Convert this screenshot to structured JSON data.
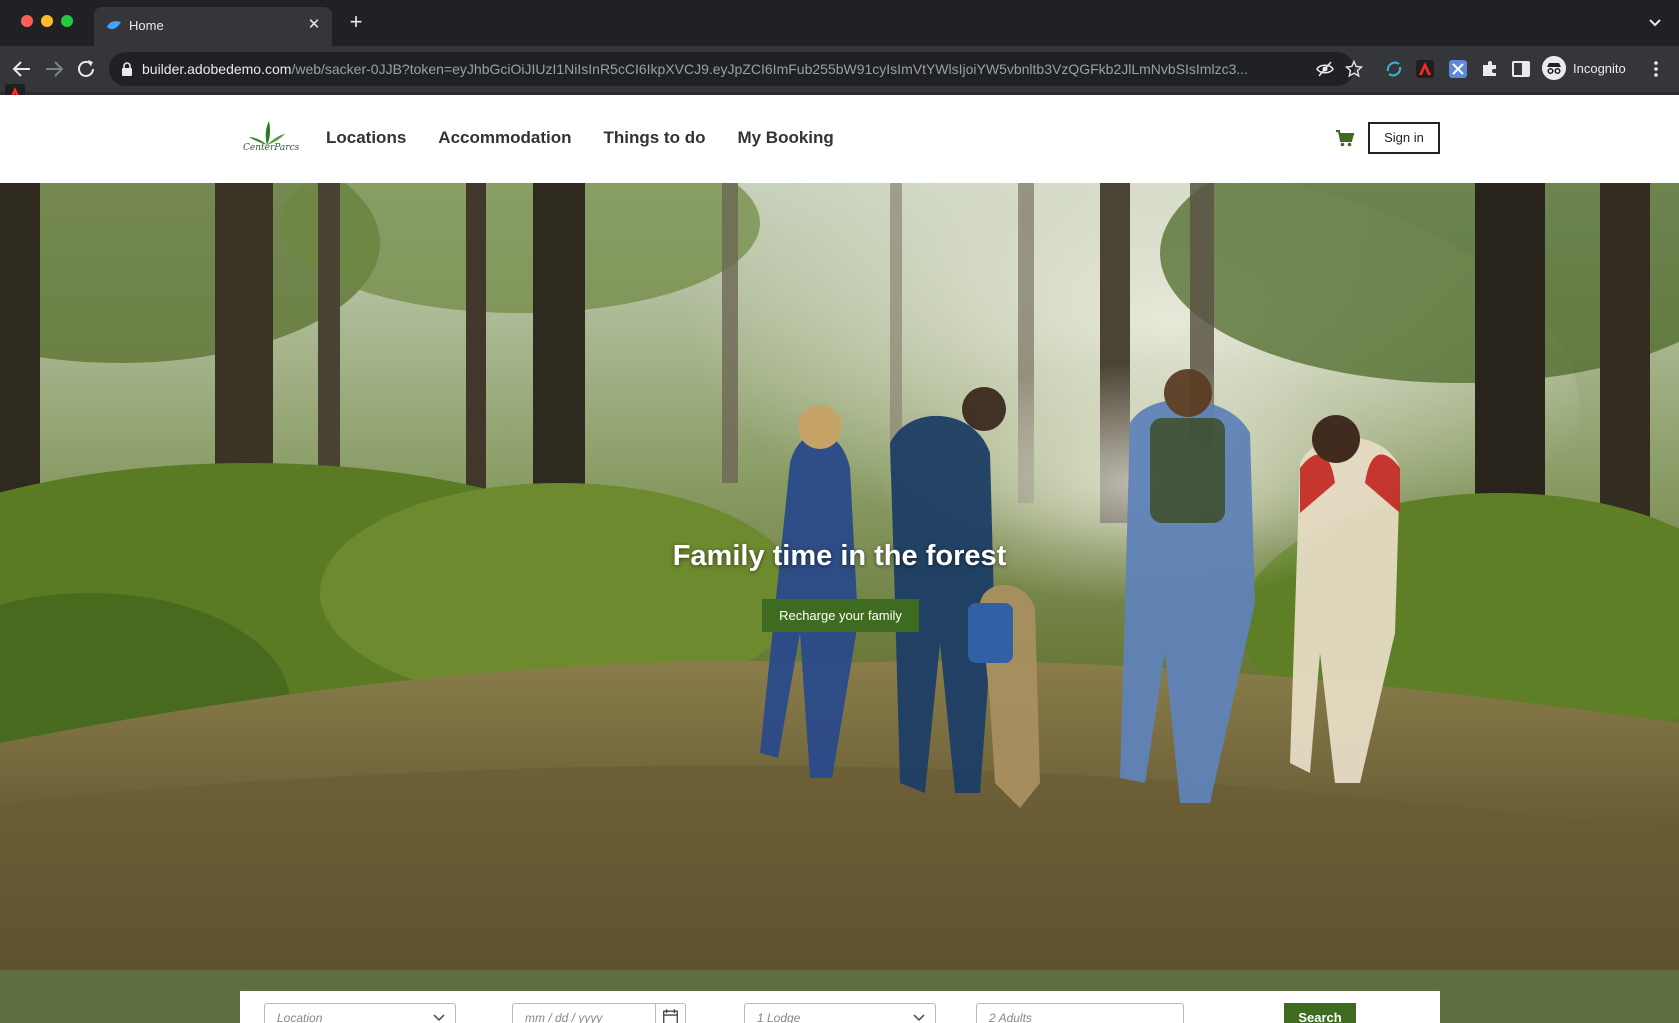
{
  "browser": {
    "tab_title": "Home",
    "new_tab_icon": "+",
    "url_host": "builder.adobedemo.com",
    "url_path": "/web/sacker-0JJB?token=eyJhbGciOiJIUzI1NiIsInR5cCI6IkpXVCJ9.eyJpZCI6ImFub255bW91cyIsImVtYWlsIjoiYW5vbnltb3VzQGFkb2JlLmNvbSIsImlzc3...",
    "profile_label": "Incognito"
  },
  "site": {
    "logo_text": "CenterParcs",
    "nav": [
      {
        "label": "Locations"
      },
      {
        "label": "Accommodation"
      },
      {
        "label": "Things to do"
      },
      {
        "label": "My Booking"
      }
    ],
    "sign_in_label": "Sign in"
  },
  "hero": {
    "title": "Family time in the forest",
    "cta_label": "Recharge your family"
  },
  "booking": {
    "location_placeholder": "Location",
    "date_placeholder": "mm / dd / yyyy",
    "lodge_value": "1 Lodge",
    "adults_placeholder": "2 Adults",
    "search_label": "Search"
  },
  "colors": {
    "brand_green": "#3e6b1f",
    "strip_green": "#5e6e41",
    "chrome_dark": "#202124",
    "chrome_toolbar": "#35363a"
  }
}
